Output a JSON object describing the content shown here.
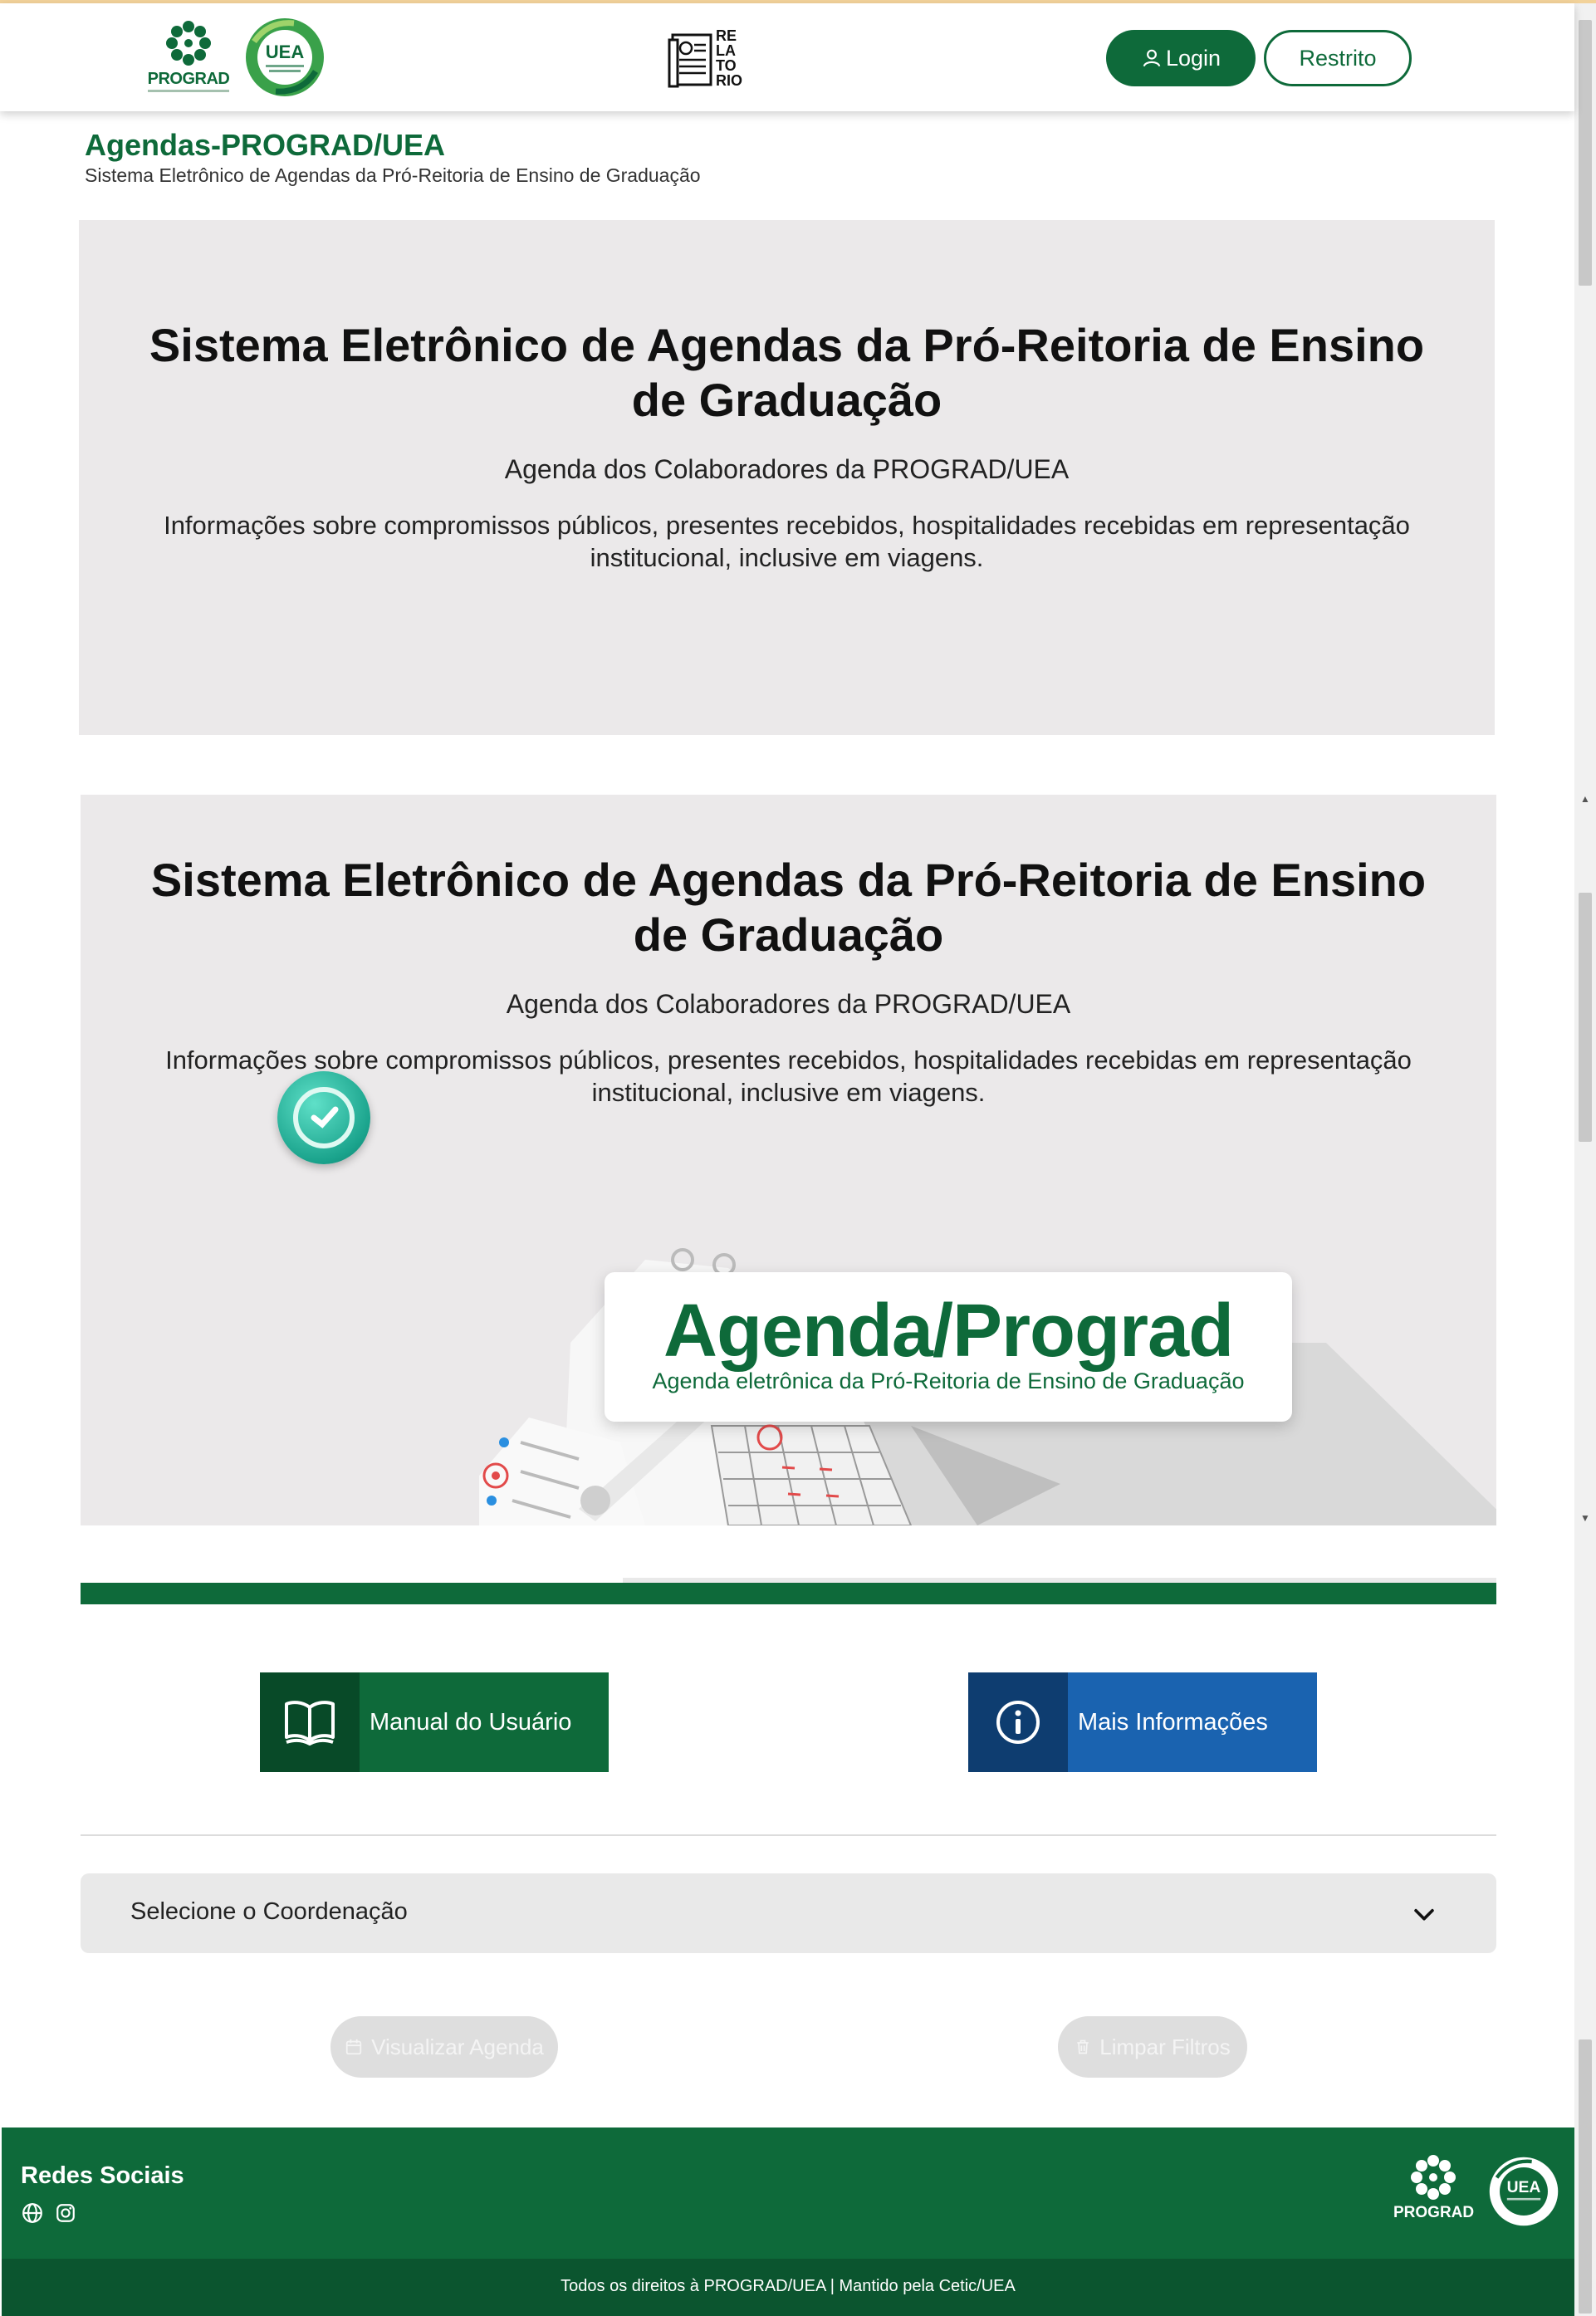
{
  "header": {
    "logo_prograd_text": "PROGRAD",
    "logo_uea_text": "UEA",
    "relatorio_lines": [
      "RE",
      "LA",
      "TO",
      "RIO"
    ],
    "login_label": "Login",
    "restrito_label": "Restrito"
  },
  "brand": {
    "title": "Agendas-PROGRAD/UEA",
    "subtitle": "Sistema Eletrônico de Agendas da Pró-Reitoria de Ensino de Graduação"
  },
  "hero": {
    "title": "Sistema Eletrônico de Agendas da Pró-Reitoria de Ensino de Graduação",
    "subtitle": "Agenda dos Colaboradores da PROGRAD/UEA",
    "description": "Informações sobre compromissos públicos, presentes recebidos, hospitalidades recebidas em representação institucional, inclusive em viagens."
  },
  "banner": {
    "title": "Agenda/Prograd",
    "subtitle": "Agenda eletrônica da Pró-Reitoria de Ensino de Graduação"
  },
  "actions": {
    "manual_label": "Manual do Usuário",
    "info_label": "Mais Informações"
  },
  "filter": {
    "coordenacao_selected": "Selecione o Coordenação"
  },
  "buttons": {
    "view_label": "Visualizar Agenda",
    "clear_label": "Limpar Filtros"
  },
  "footer": {
    "social_title": "Redes Sociais",
    "social_icons": [
      "globe-icon",
      "instagram-icon"
    ],
    "logo_prograd_text": "PROGRAD",
    "logo_uea_text": "UEA",
    "copyright": "Todos os direitos à PROGRAD/UEA | Mantido pela Cetic/UEA"
  },
  "colors": {
    "primary_green": "#0e6a3a",
    "dark_green": "#0b552f",
    "info_blue": "#1a63b0",
    "hero_bg": "#ebe9ea"
  }
}
